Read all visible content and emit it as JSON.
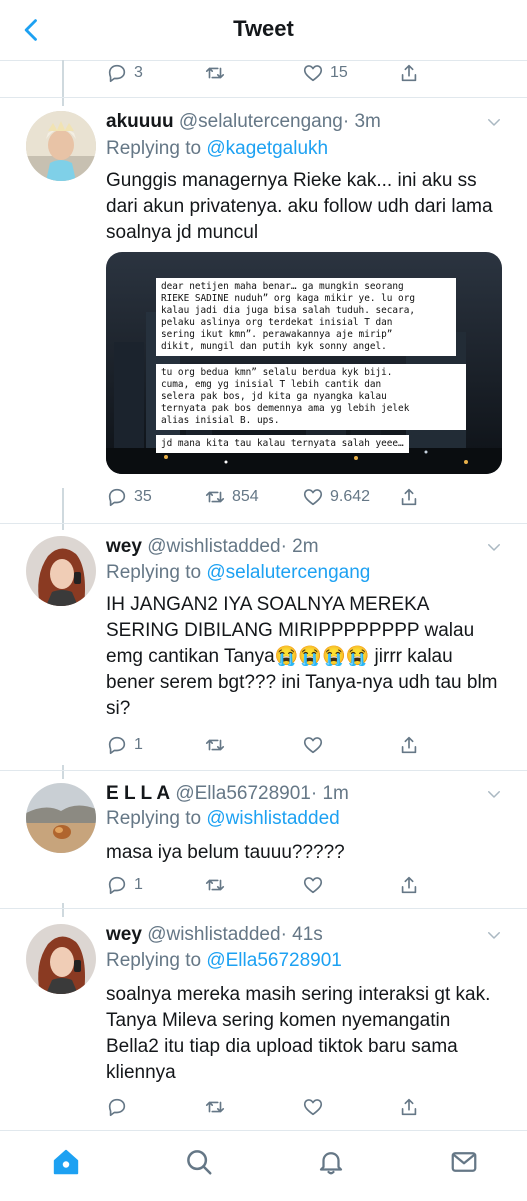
{
  "header": {
    "title": "Tweet"
  },
  "top_actions": {
    "replies": "3",
    "likes": "15"
  },
  "tweets": [
    {
      "name": "akuuuu",
      "handle": "@selalutercengang",
      "time": "· 3m",
      "reply_prefix": "Replying to",
      "reply_to": "@kagetgalukh",
      "text": "Gunggis managernya Rieke kak... ini aku ss dari akun privatenya. aku follow udh dari lama soalnya jd muncul",
      "media_lines": [
        "dear netijen maha benar… ga mungkin seorang\nRIEKE SADINE nuduh” org kaga mikir ye. lu org\nkalau jadi dia juga bisa salah tuduh. secara,\npelaku aslinya org terdekat inisial T dan\nsering ikut kmn”. perawakannya aje mirip”\ndikit, mungil dan putih kyk sonny angel.",
        "tu org bedua kmn” selalu berdua kyk biji.\ncuma, emg yg inisial T lebih cantik dan\nselera pak bos, jd kita ga nyangka kalau\nternyata pak bos demennya ama yg lebih jelek\nalias inisial B. ups.",
        "jd mana kita tau kalau ternyata salah yeee…"
      ],
      "replies": "35",
      "retweets": "854",
      "likes": "9.642"
    },
    {
      "name": "wey",
      "handle": "@wishlistadded",
      "time": "· 2m",
      "reply_prefix": "Replying to",
      "reply_to": "@selalutercengang",
      "text": "IH JANGAN2 IYA SOALNYA MEREKA SERING DIBILANG MIRIPPPPPPPP walau emg cantikan Tanya😭😭😭😭 jirrr kalau bener serem bgt??? ini Tanya-nya udh tau blm si?",
      "replies": "1",
      "retweets": "",
      "likes": ""
    },
    {
      "name": "E L L A",
      "handle": "@Ella56728901",
      "time": "· 1m",
      "reply_prefix": "Replying to",
      "reply_to": "@wishlistadded",
      "text": "masa iya belum tauuu?????",
      "replies": "1",
      "retweets": "",
      "likes": ""
    },
    {
      "name": "wey",
      "handle": "@wishlistadded",
      "time": "· 41s",
      "reply_prefix": "Replying to",
      "reply_to": "@Ella56728901",
      "text": "soalnya mereka masih sering interaksi gt kak. Tanya Mileva sering komen nyemangatin Bella2 itu tiap dia upload tiktok baru sama kliennya",
      "replies": "",
      "retweets": "",
      "likes": ""
    }
  ],
  "colors": {
    "accent": "#1da1f2",
    "secondary": "#657786",
    "text": "#14171a",
    "border": "#e1e8ed"
  },
  "icons": {
    "back": "chevron-left-icon",
    "reply": "reply-icon",
    "retweet": "retweet-icon",
    "like": "heart-icon",
    "share": "share-icon",
    "caret": "chevron-down-icon",
    "home": "home-icon",
    "search": "search-icon",
    "notifications": "bell-icon",
    "messages": "mail-icon"
  }
}
